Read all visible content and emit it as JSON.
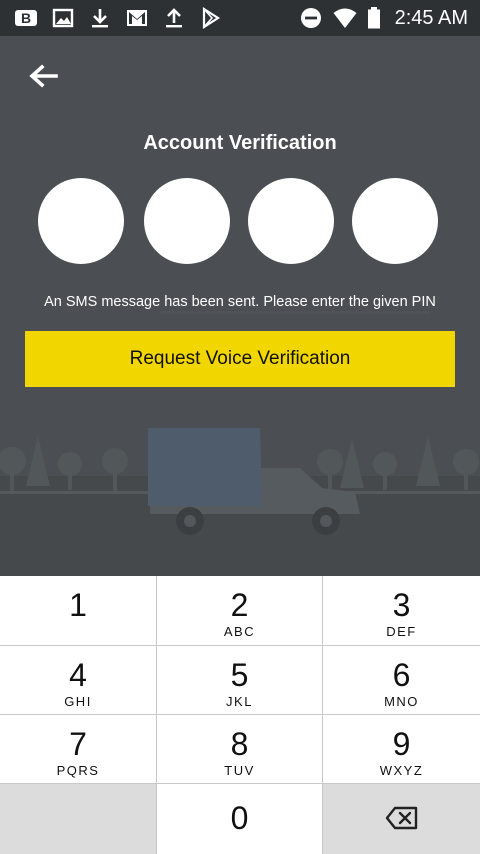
{
  "status_bar": {
    "left_icons": [
      "b-app-icon",
      "image-icon",
      "download-icon",
      "gmail-icon",
      "upload-icon",
      "play-store-icon"
    ],
    "right_icons": [
      "do-not-disturb-icon",
      "wifi-icon",
      "battery-icon"
    ],
    "time": "2:45 AM"
  },
  "header": {
    "back_icon": "arrow-left-icon",
    "title": "Account Verification"
  },
  "pin_inputs": [
    "",
    "",
    "",
    ""
  ],
  "info_text": "An SMS message has been sent. Please enter the given PIN",
  "voice_button_label": "Request Voice Verification",
  "colors": {
    "accent": "#f1d600",
    "background": "#4b4f53",
    "status_bar": "#2e3134"
  },
  "keypad": {
    "keys": [
      {
        "num": "1",
        "letters": ""
      },
      {
        "num": "2",
        "letters": "ABC"
      },
      {
        "num": "3",
        "letters": "DEF"
      },
      {
        "num": "4",
        "letters": "GHI"
      },
      {
        "num": "5",
        "letters": "JKL"
      },
      {
        "num": "6",
        "letters": "MNO"
      },
      {
        "num": "7",
        "letters": "PQRS"
      },
      {
        "num": "8",
        "letters": "TUV"
      },
      {
        "num": "9",
        "letters": "WXYZ"
      },
      {
        "num": "0",
        "letters": ""
      }
    ],
    "backspace_icon": "backspace-icon"
  }
}
